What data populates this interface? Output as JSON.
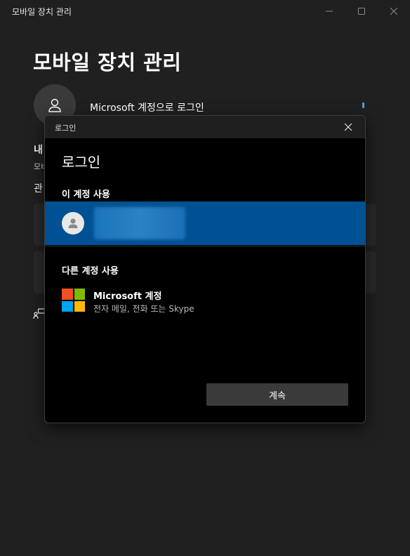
{
  "window": {
    "title": "모바일 장치 관리",
    "controls": {
      "minimize_icon": "minimize-icon",
      "maximize_icon": "maximize-icon",
      "close_icon": "close-icon"
    }
  },
  "app": {
    "heading": "모바일 장치 관리",
    "signin_link": "Microsoft 계정으로 로그인",
    "section_title_partial": "내",
    "section_sub_partial": "모비",
    "manage_partial": "관"
  },
  "dialog": {
    "title": "로그인",
    "heading": "로그인",
    "use_this_account_label": "이 계정 사용",
    "other_account_label": "다른 계정 사용",
    "microsoft_option": {
      "title": "Microsoft 계정",
      "subtitle": "전자 메일, 전화 또는 Skype"
    },
    "continue_button": "계속"
  },
  "colors": {
    "window_bg": "#202020",
    "dialog_bg": "#000000",
    "selected_row": "#005193",
    "button_bg": "#3a3a3a",
    "ms_red": "#f25022",
    "ms_green": "#7fba00",
    "ms_blue": "#00a4ef",
    "ms_yellow": "#ffb900"
  }
}
